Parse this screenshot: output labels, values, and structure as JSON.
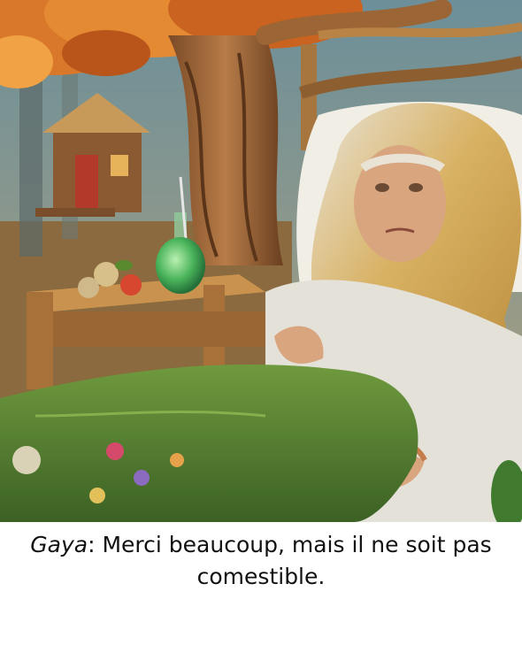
{
  "caption": {
    "speaker": "Gaya",
    "separator": ": ",
    "line": "Merci beaucoup, mais il ne soit pas comestible."
  },
  "palette": {
    "foliage": "#d9772a",
    "trunk": "#a06a3c",
    "blanket": "#4f7a2e",
    "potion": "#5cc26a",
    "hair": "#d9a94a",
    "pillow": "#f1eee6",
    "gown": "#e4e1d8"
  },
  "icons": [
    "autumn-tree",
    "wooden-hut",
    "potion-flask",
    "fruit-bowl",
    "sick-woman",
    "green-blanket"
  ]
}
